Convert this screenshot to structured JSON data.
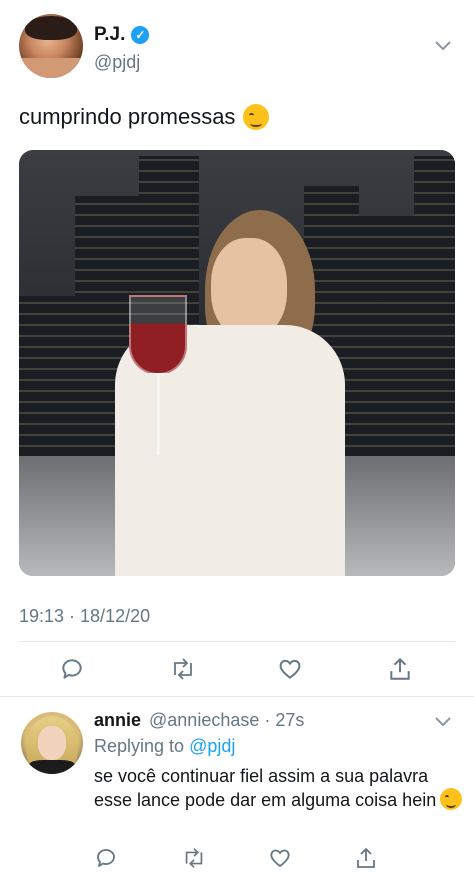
{
  "tweet": {
    "display_name": "P.J.",
    "verified_symbol": "✓",
    "handle": "@pjdj",
    "text": "cumprindo promessas",
    "emoji": "wink-emoji",
    "timestamp": "19:13 · 18/12/20"
  },
  "actions": [
    "reply-icon",
    "retweet-icon",
    "like-icon",
    "share-icon"
  ],
  "reply": {
    "name": "annie",
    "meta": "@anniechase · 27s",
    "replying_prefix": "Replying to",
    "replying_to": "@pjdj",
    "text": "se você continuar fiel assim a sua palavra esse lance pode dar em alguma coisa hein",
    "emoji": "smirk-emoji"
  },
  "colors": {
    "accent": "#1da1f2",
    "muted": "#657786",
    "divider": "#e1e8ed",
    "text": "#14171a"
  }
}
